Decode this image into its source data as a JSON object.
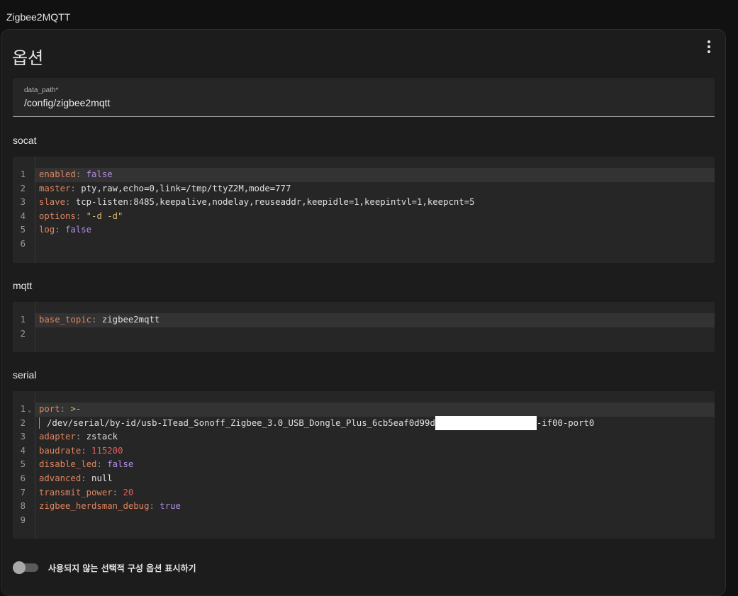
{
  "app_title": "Zigbee2MQTT",
  "card_title": "옵션",
  "data_path": {
    "label": "data_path*",
    "value": "/config/zigbee2mqtt"
  },
  "sections": {
    "socat": "socat",
    "mqtt": "mqtt",
    "serial": "serial"
  },
  "socat_lines": [
    {
      "num": "1",
      "key": "enabled",
      "value": "false",
      "type": "bool"
    },
    {
      "num": "2",
      "key": "master",
      "value": "pty,raw,echo=0,link=/tmp/ttyZ2M,mode=777",
      "type": "str"
    },
    {
      "num": "3",
      "key": "slave",
      "value": "tcp-listen:8485,keepalive,nodelay,reuseaddr,keepidle=1,keepintvl=1,keepcnt=5",
      "type": "str"
    },
    {
      "num": "4",
      "key": "options",
      "value": "\"-d -d\"",
      "type": "quoted"
    },
    {
      "num": "5",
      "key": "log",
      "value": "false",
      "type": "bool"
    },
    {
      "num": "6",
      "key": "",
      "value": "",
      "type": "empty"
    }
  ],
  "mqtt_lines": [
    {
      "num": "1",
      "key": "base_topic",
      "value": "zigbee2mqtt",
      "type": "str"
    },
    {
      "num": "2",
      "key": "",
      "value": "",
      "type": "empty"
    }
  ],
  "serial_lines": [
    {
      "num": "1",
      "key": "port",
      "value": ">-",
      "type": "block"
    },
    {
      "num": "2",
      "key": "",
      "value": "/dev/serial/by-id/usb-ITead_Sonoff_Zigbee_3.0_USB_Dongle_Plus_6cb5eaf0d99d",
      "value_suffix": "-if00-port0",
      "type": "cont"
    },
    {
      "num": "3",
      "key": "adapter",
      "value": "zstack",
      "type": "str"
    },
    {
      "num": "4",
      "key": "baudrate",
      "value": "115200",
      "type": "num"
    },
    {
      "num": "5",
      "key": "disable_led",
      "value": "false",
      "type": "bool"
    },
    {
      "num": "6",
      "key": "advanced",
      "value": "null",
      "type": "str"
    },
    {
      "num": "7",
      "key": "transmit_power",
      "value": "20",
      "type": "num"
    },
    {
      "num": "8",
      "key": "zigbee_herdsman_debug",
      "value": "true",
      "type": "bool"
    },
    {
      "num": "9",
      "key": "",
      "value": "",
      "type": "empty"
    }
  ],
  "toggle": {
    "label": "사용되지 않는 선택적 구성 옵션 표시하기",
    "on": false
  },
  "colors": {
    "key": "#e0855f",
    "bool": "#b48ee6",
    "number": "#e35d5d",
    "string": "#d9b86c"
  }
}
